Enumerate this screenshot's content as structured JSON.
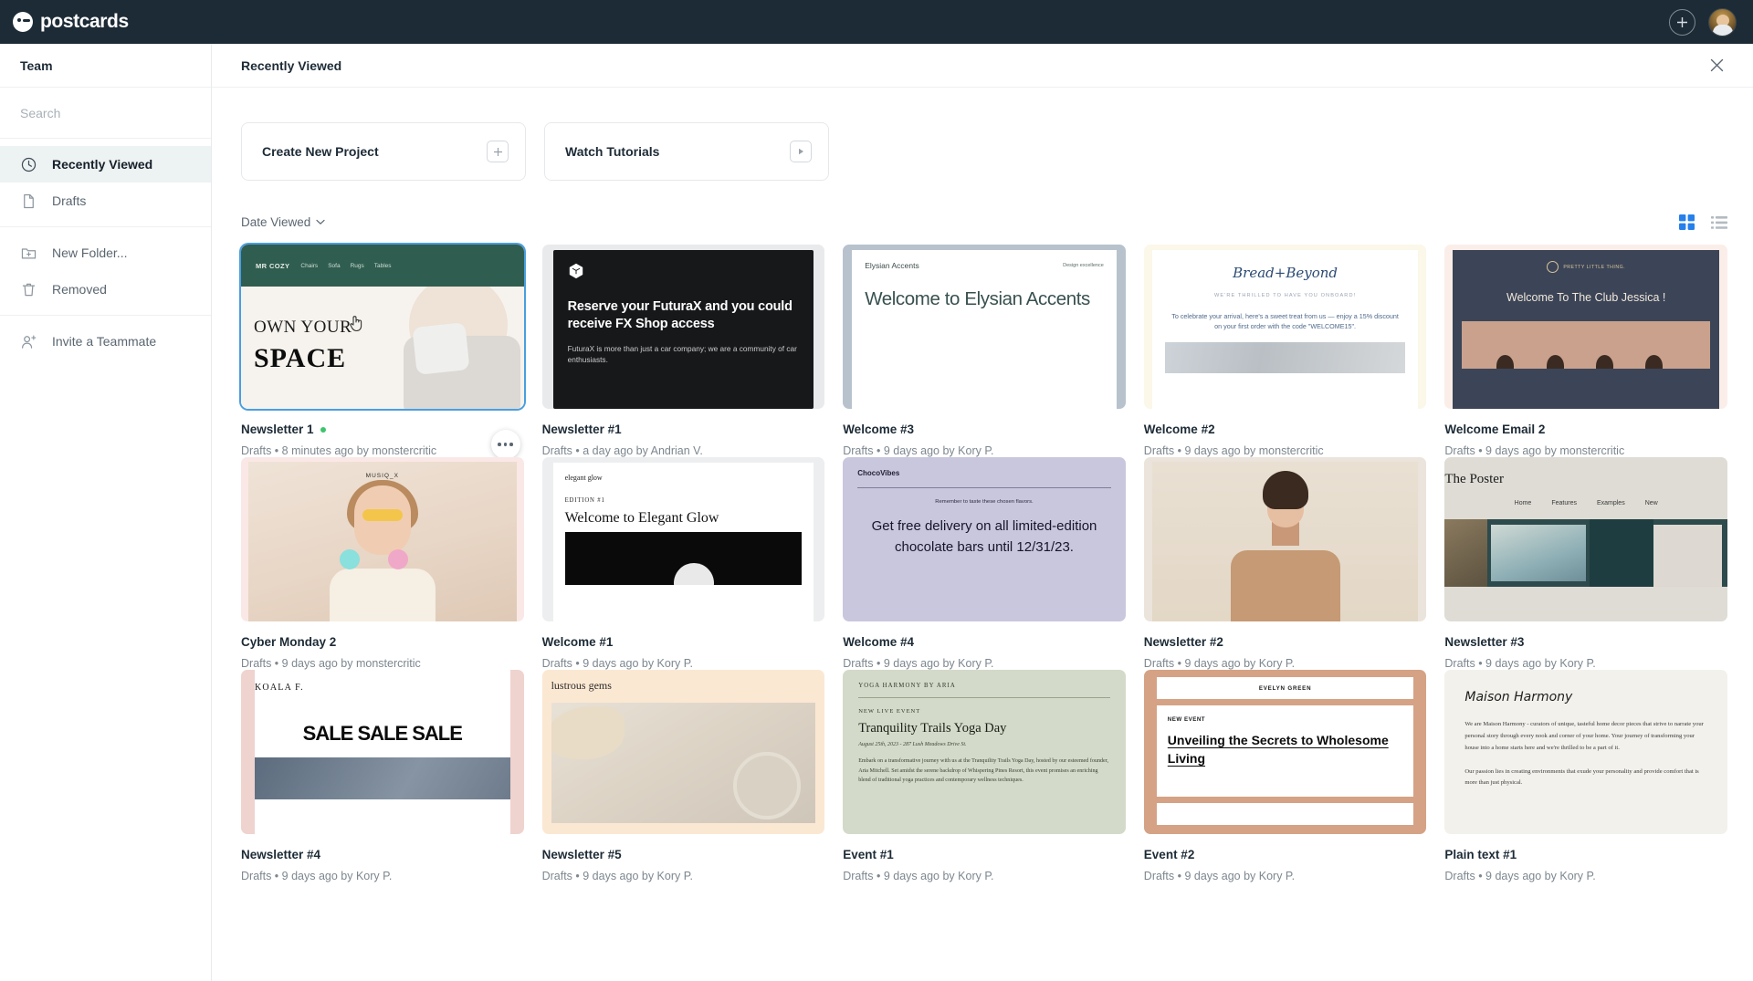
{
  "topbar": {
    "brand": "postcards",
    "add_label": "+",
    "icons": {
      "add": "plus-circle-icon",
      "avatar": "user-avatar"
    }
  },
  "sidebar": {
    "team_label": "Team",
    "search_placeholder": "Search",
    "search_value": "",
    "groups": [
      {
        "items": [
          {
            "label": "Recently Viewed",
            "icon": "clock-icon",
            "active": true
          },
          {
            "label": "Drafts",
            "icon": "document-icon",
            "active": false
          }
        ]
      },
      {
        "items": [
          {
            "label": "New Folder...",
            "icon": "folder-plus-icon",
            "active": false
          },
          {
            "label": "Removed",
            "icon": "trash-icon",
            "active": false
          }
        ]
      },
      {
        "items": [
          {
            "label": "Invite a Teammate",
            "icon": "user-plus-icon",
            "active": false
          }
        ]
      }
    ]
  },
  "main": {
    "title": "Recently Viewed",
    "close_icon": "close-icon",
    "actions": [
      {
        "label": "Create New Project",
        "icon": "plus-square-icon"
      },
      {
        "label": "Watch Tutorials",
        "icon": "play-square-icon"
      }
    ],
    "sort": {
      "label": "Date Viewed",
      "icon": "chevron-down-icon"
    },
    "views": [
      {
        "name": "grid-view-toggle",
        "active": true,
        "color": "#2680eb"
      },
      {
        "name": "list-view-toggle",
        "active": false,
        "color": "#b3bac0"
      }
    ]
  },
  "projects": [
    {
      "title": "Newsletter 1",
      "status_dot": true,
      "folder": "Drafts",
      "time": "8 minutes ago",
      "by": "by monstercritic",
      "meta": "Drafts  •  8 minutes ago by monstercritic",
      "selected": true,
      "design": "cozy",
      "thumb": {
        "logo": "MR COZY",
        "nav": [
          "Chairs",
          "Sofa",
          "Rugs",
          "Tables"
        ],
        "h1": "OWN YOUR",
        "h2": "SPACE"
      }
    },
    {
      "title": "Newsletter #1",
      "status_dot": false,
      "folder": "Drafts",
      "time": "a day ago",
      "by": "by Andrian V.",
      "meta": "Drafts  •  a day ago by Andrian V.",
      "selected": false,
      "design": "futura",
      "thumb": {
        "head": "Reserve your FuturaX and you could receive FX Shop access",
        "sub": "FuturaX is more than just a car company; we are a community of car enthusiasts."
      }
    },
    {
      "title": "Welcome #3",
      "status_dot": false,
      "folder": "Drafts",
      "time": "9 days ago",
      "by": "by Kory P.",
      "meta": "Drafts  •  9 days ago by Kory P.",
      "selected": false,
      "design": "elysian",
      "thumb": {
        "brand": "Elysian Accents",
        "tag": "Design excellence",
        "big": "Welcome to Elysian Accents"
      }
    },
    {
      "title": "Welcome #2",
      "status_dot": false,
      "folder": "Drafts",
      "time": "9 days ago",
      "by": "by monstercritic",
      "meta": "Drafts  •  9 days ago by monstercritic",
      "selected": false,
      "design": "bread",
      "thumb": {
        "brand": "Bread+Beyond",
        "kick": "WE'RE THRILLED TO HAVE YOU ONBOARD!",
        "para": "To celebrate your arrival, here's a sweet treat from us — enjoy a 15% discount on your first order with the code \"WELCOME15\"."
      }
    },
    {
      "title": "Welcome Email 2",
      "status_dot": false,
      "folder": "Drafts",
      "time": "9 days ago",
      "by": "by monstercritic",
      "meta": "Drafts  •  9 days ago by monstercritic",
      "selected": false,
      "design": "club",
      "thumb": {
        "brand": "PRETTY LITTLE THING.",
        "title": "Welcome To The Club Jessica !"
      }
    },
    {
      "title": "Cyber Monday 2",
      "status_dot": false,
      "folder": "Drafts",
      "time": "9 days ago",
      "by": "by monstercritic",
      "meta": "Drafts  •  9 days ago by monstercritic",
      "selected": false,
      "design": "musiq",
      "thumb": {
        "label": "MUSIQ_X"
      }
    },
    {
      "title": "Welcome #1",
      "status_dot": false,
      "folder": "Drafts",
      "time": "9 days ago",
      "by": "by Kory P.",
      "meta": "Drafts  •  9 days ago by Kory P.",
      "selected": false,
      "design": "glow",
      "thumb": {
        "brand": "elegant glow",
        "edition": "EDITION #1",
        "big": "Welcome to Elegant Glow"
      }
    },
    {
      "title": "Welcome #4",
      "status_dot": false,
      "folder": "Drafts",
      "time": "9 days ago",
      "by": "by Kory P.",
      "meta": "Drafts  •  9 days ago by Kory P.",
      "selected": false,
      "design": "choco",
      "thumb": {
        "brand": "ChocoVibes",
        "sub": "Remember to taste these chosen flavors.",
        "big": "Get free delivery on all limited-edition chocolate bars until 12/31/23."
      }
    },
    {
      "title": "Newsletter #2",
      "status_dot": false,
      "folder": "Drafts",
      "time": "9 days ago",
      "by": "by Kory P.",
      "meta": "Drafts  •  9 days ago by Kory P.",
      "selected": false,
      "design": "turtle",
      "thumb": {}
    },
    {
      "title": "Newsletter #3",
      "status_dot": false,
      "folder": "Drafts",
      "time": "9 days ago",
      "by": "by Kory P.",
      "meta": "Drafts  •  9 days ago by Kory P.",
      "selected": false,
      "design": "poster",
      "thumb": {
        "brand": "The Poster",
        "nav": [
          "Home",
          "Features",
          "Examples",
          "New"
        ]
      }
    },
    {
      "title": "Newsletter #4",
      "status_dot": false,
      "folder": "Drafts",
      "time": "9 days ago",
      "by": "by Kory P.",
      "meta": "Drafts  •  9 days ago by Kory P.",
      "selected": false,
      "design": "koala",
      "thumb": {
        "brand": "KOALA F.",
        "sale": "SALE SALE SALE"
      }
    },
    {
      "title": "Newsletter #5",
      "status_dot": false,
      "folder": "Drafts",
      "time": "9 days ago",
      "by": "by Kory P.",
      "meta": "Drafts  •  9 days ago by Kory P.",
      "selected": false,
      "design": "gems",
      "thumb": {
        "brand": "lustrous gems"
      }
    },
    {
      "title": "Event #1",
      "status_dot": false,
      "folder": "Drafts",
      "time": "9 days ago",
      "by": "by Kory P.",
      "meta": "Drafts  •  9 days ago by Kory P.",
      "selected": false,
      "design": "yoga",
      "thumb": {
        "brand": "YOGA HARMONY BY ARIA",
        "kick": "NEW LIVE EVENT",
        "big": "Tranquility Trails Yoga Day",
        "date": "August 25th, 2023 - 287 Lush Meadows Drive St.",
        "para": "Embark on a transformative journey with us at the Tranquility Trails Yoga Day, hosted by our esteemed founder, Aria Mitchell. Set amidst the serene backdrop of Whispering Pines Resort, this event promises an enriching blend of traditional yoga practices and contemporary wellness techniques."
      }
    },
    {
      "title": "Event #2",
      "status_dot": false,
      "folder": "Drafts",
      "time": "9 days ago",
      "by": "by Kory P.",
      "meta": "Drafts  •  9 days ago by Kory P.",
      "selected": false,
      "design": "evelyn",
      "thumb": {
        "brand": "EVELYN GREEN",
        "kick": "NEW EVENT",
        "big": "Unveiling the Secrets to Wholesome Living"
      }
    },
    {
      "title": "Plain text #1",
      "status_dot": false,
      "folder": "Drafts",
      "time": "9 days ago",
      "by": "by Kory P.",
      "meta": "Drafts  •  9 days ago by Kory P.",
      "selected": false,
      "design": "maison",
      "thumb": {
        "brand": "Maison Harmony",
        "para": "We are Maison Harmony - curators of unique, tasteful home decor pieces that strive to narrate your personal story through every nook and corner of your home. Your journey of transforming your house into a home starts here and we're thrilled to be a part of it.",
        "para2": "Our passion lies in creating environments that exude your personality and provide comfort that is more than just physical."
      }
    }
  ],
  "colors": {
    "topbar": "#1d2b36",
    "accent": "#2680eb",
    "selection": "#4a9ee0",
    "status_dot": "#3ec46d"
  }
}
